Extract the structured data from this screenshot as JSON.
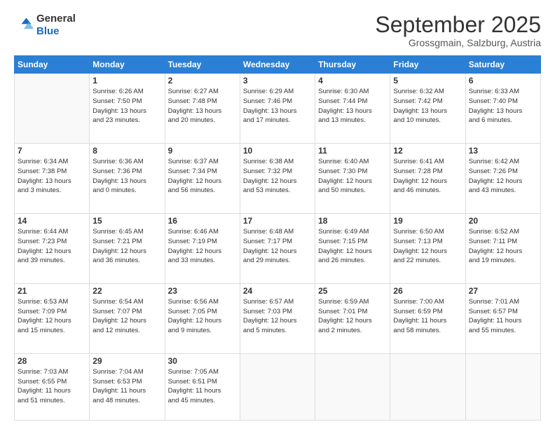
{
  "header": {
    "logo_general": "General",
    "logo_blue": "Blue",
    "month_title": "September 2025",
    "location": "Grossgmain, Salzburg, Austria"
  },
  "weekdays": [
    "Sunday",
    "Monday",
    "Tuesday",
    "Wednesday",
    "Thursday",
    "Friday",
    "Saturday"
  ],
  "weeks": [
    [
      {
        "day": "",
        "info": ""
      },
      {
        "day": "1",
        "info": "Sunrise: 6:26 AM\nSunset: 7:50 PM\nDaylight: 13 hours\nand 23 minutes."
      },
      {
        "day": "2",
        "info": "Sunrise: 6:27 AM\nSunset: 7:48 PM\nDaylight: 13 hours\nand 20 minutes."
      },
      {
        "day": "3",
        "info": "Sunrise: 6:29 AM\nSunset: 7:46 PM\nDaylight: 13 hours\nand 17 minutes."
      },
      {
        "day": "4",
        "info": "Sunrise: 6:30 AM\nSunset: 7:44 PM\nDaylight: 13 hours\nand 13 minutes."
      },
      {
        "day": "5",
        "info": "Sunrise: 6:32 AM\nSunset: 7:42 PM\nDaylight: 13 hours\nand 10 minutes."
      },
      {
        "day": "6",
        "info": "Sunrise: 6:33 AM\nSunset: 7:40 PM\nDaylight: 13 hours\nand 6 minutes."
      }
    ],
    [
      {
        "day": "7",
        "info": "Sunrise: 6:34 AM\nSunset: 7:38 PM\nDaylight: 13 hours\nand 3 minutes."
      },
      {
        "day": "8",
        "info": "Sunrise: 6:36 AM\nSunset: 7:36 PM\nDaylight: 13 hours\nand 0 minutes."
      },
      {
        "day": "9",
        "info": "Sunrise: 6:37 AM\nSunset: 7:34 PM\nDaylight: 12 hours\nand 56 minutes."
      },
      {
        "day": "10",
        "info": "Sunrise: 6:38 AM\nSunset: 7:32 PM\nDaylight: 12 hours\nand 53 minutes."
      },
      {
        "day": "11",
        "info": "Sunrise: 6:40 AM\nSunset: 7:30 PM\nDaylight: 12 hours\nand 50 minutes."
      },
      {
        "day": "12",
        "info": "Sunrise: 6:41 AM\nSunset: 7:28 PM\nDaylight: 12 hours\nand 46 minutes."
      },
      {
        "day": "13",
        "info": "Sunrise: 6:42 AM\nSunset: 7:26 PM\nDaylight: 12 hours\nand 43 minutes."
      }
    ],
    [
      {
        "day": "14",
        "info": "Sunrise: 6:44 AM\nSunset: 7:23 PM\nDaylight: 12 hours\nand 39 minutes."
      },
      {
        "day": "15",
        "info": "Sunrise: 6:45 AM\nSunset: 7:21 PM\nDaylight: 12 hours\nand 36 minutes."
      },
      {
        "day": "16",
        "info": "Sunrise: 6:46 AM\nSunset: 7:19 PM\nDaylight: 12 hours\nand 33 minutes."
      },
      {
        "day": "17",
        "info": "Sunrise: 6:48 AM\nSunset: 7:17 PM\nDaylight: 12 hours\nand 29 minutes."
      },
      {
        "day": "18",
        "info": "Sunrise: 6:49 AM\nSunset: 7:15 PM\nDaylight: 12 hours\nand 26 minutes."
      },
      {
        "day": "19",
        "info": "Sunrise: 6:50 AM\nSunset: 7:13 PM\nDaylight: 12 hours\nand 22 minutes."
      },
      {
        "day": "20",
        "info": "Sunrise: 6:52 AM\nSunset: 7:11 PM\nDaylight: 12 hours\nand 19 minutes."
      }
    ],
    [
      {
        "day": "21",
        "info": "Sunrise: 6:53 AM\nSunset: 7:09 PM\nDaylight: 12 hours\nand 15 minutes."
      },
      {
        "day": "22",
        "info": "Sunrise: 6:54 AM\nSunset: 7:07 PM\nDaylight: 12 hours\nand 12 minutes."
      },
      {
        "day": "23",
        "info": "Sunrise: 6:56 AM\nSunset: 7:05 PM\nDaylight: 12 hours\nand 9 minutes."
      },
      {
        "day": "24",
        "info": "Sunrise: 6:57 AM\nSunset: 7:03 PM\nDaylight: 12 hours\nand 5 minutes."
      },
      {
        "day": "25",
        "info": "Sunrise: 6:59 AM\nSunset: 7:01 PM\nDaylight: 12 hours\nand 2 minutes."
      },
      {
        "day": "26",
        "info": "Sunrise: 7:00 AM\nSunset: 6:59 PM\nDaylight: 11 hours\nand 58 minutes."
      },
      {
        "day": "27",
        "info": "Sunrise: 7:01 AM\nSunset: 6:57 PM\nDaylight: 11 hours\nand 55 minutes."
      }
    ],
    [
      {
        "day": "28",
        "info": "Sunrise: 7:03 AM\nSunset: 6:55 PM\nDaylight: 11 hours\nand 51 minutes."
      },
      {
        "day": "29",
        "info": "Sunrise: 7:04 AM\nSunset: 6:53 PM\nDaylight: 11 hours\nand 48 minutes."
      },
      {
        "day": "30",
        "info": "Sunrise: 7:05 AM\nSunset: 6:51 PM\nDaylight: 11 hours\nand 45 minutes."
      },
      {
        "day": "",
        "info": ""
      },
      {
        "day": "",
        "info": ""
      },
      {
        "day": "",
        "info": ""
      },
      {
        "day": "",
        "info": ""
      }
    ]
  ]
}
